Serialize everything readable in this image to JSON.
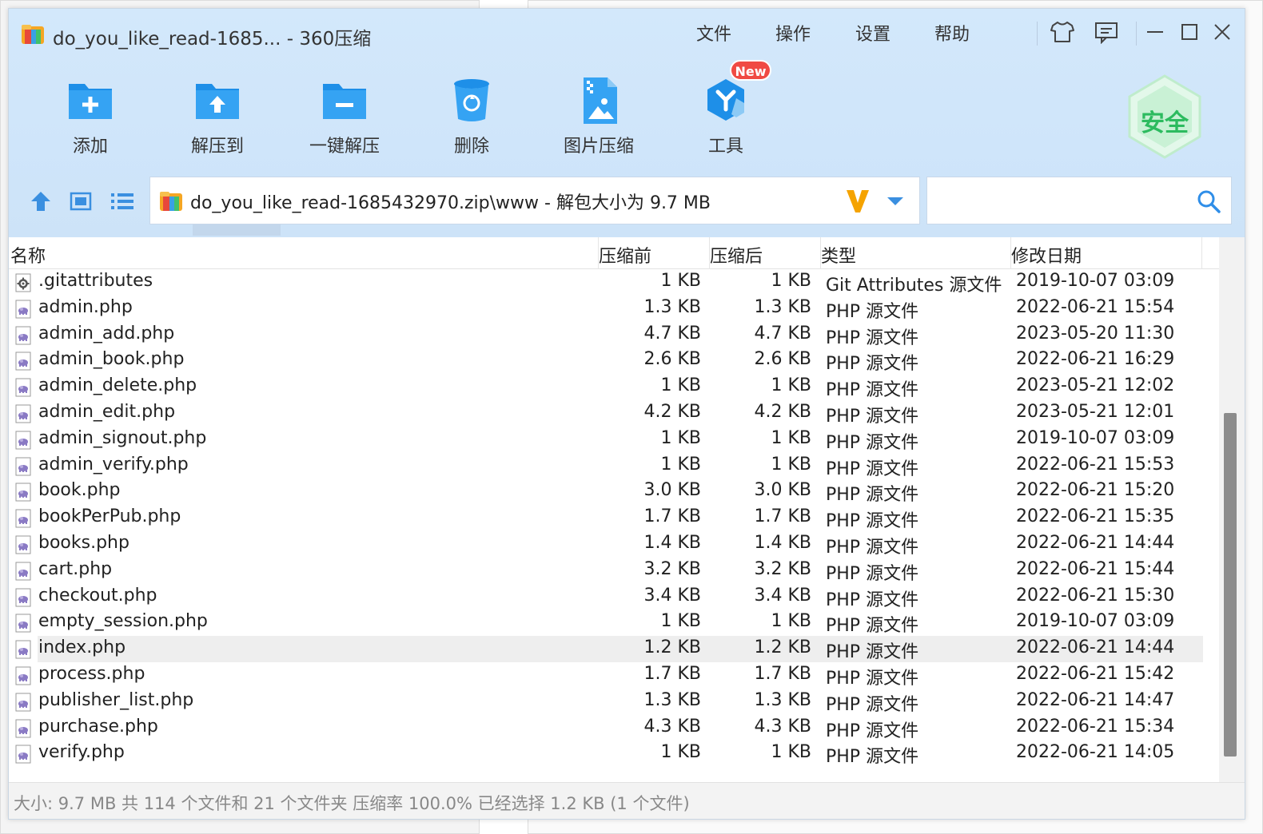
{
  "window": {
    "title": "do_you_like_read-1685... - 360压缩"
  },
  "menu": [
    "文件",
    "操作",
    "设置",
    "帮助"
  ],
  "window_controls": {
    "skin": "shirt-icon",
    "feedback": "message-icon",
    "minimize": "minimize-icon",
    "maximize": "maximize-icon",
    "close": "close-icon"
  },
  "toolbar": {
    "items": [
      {
        "label": "添加",
        "icon": "add-folder-icon"
      },
      {
        "label": "解压到",
        "icon": "extract-to-icon"
      },
      {
        "label": "一键解压",
        "icon": "one-click-extract-icon"
      },
      {
        "label": "删除",
        "icon": "delete-icon"
      },
      {
        "label": "图片压缩",
        "icon": "image-compress-icon"
      },
      {
        "label": "工具",
        "icon": "tools-icon"
      }
    ],
    "new_badge": "New",
    "security_label": "安全"
  },
  "address": {
    "path": "do_you_like_read-1685432970.zip\\www - 解包大小为 9.7 MB"
  },
  "search": {
    "placeholder": ""
  },
  "columns": {
    "name": "名称",
    "size": "压缩前",
    "compressed": "压缩后",
    "type": "类型",
    "modified": "修改日期"
  },
  "files": [
    {
      "name": ".gitattributes",
      "size": "1 KB",
      "compressed": "1 KB",
      "type": "Git Attributes 源文件",
      "modified": "2019-10-07 03:09",
      "icon": "settings-file-icon"
    },
    {
      "name": "admin.php",
      "size": "1.3 KB",
      "compressed": "1.3 KB",
      "type": "PHP 源文件",
      "modified": "2022-06-21 15:54",
      "icon": "php-file-icon"
    },
    {
      "name": "admin_add.php",
      "size": "4.7 KB",
      "compressed": "4.7 KB",
      "type": "PHP 源文件",
      "modified": "2023-05-20 11:30",
      "icon": "php-file-icon"
    },
    {
      "name": "admin_book.php",
      "size": "2.6 KB",
      "compressed": "2.6 KB",
      "type": "PHP 源文件",
      "modified": "2022-06-21 16:29",
      "icon": "php-file-icon"
    },
    {
      "name": "admin_delete.php",
      "size": "1 KB",
      "compressed": "1 KB",
      "type": "PHP 源文件",
      "modified": "2023-05-21 12:02",
      "icon": "php-file-icon"
    },
    {
      "name": "admin_edit.php",
      "size": "4.2 KB",
      "compressed": "4.2 KB",
      "type": "PHP 源文件",
      "modified": "2023-05-21 12:01",
      "icon": "php-file-icon"
    },
    {
      "name": "admin_signout.php",
      "size": "1 KB",
      "compressed": "1 KB",
      "type": "PHP 源文件",
      "modified": "2019-10-07 03:09",
      "icon": "php-file-icon"
    },
    {
      "name": "admin_verify.php",
      "size": "1 KB",
      "compressed": "1 KB",
      "type": "PHP 源文件",
      "modified": "2022-06-21 15:53",
      "icon": "php-file-icon"
    },
    {
      "name": "book.php",
      "size": "3.0 KB",
      "compressed": "3.0 KB",
      "type": "PHP 源文件",
      "modified": "2022-06-21 15:20",
      "icon": "php-file-icon"
    },
    {
      "name": "bookPerPub.php",
      "size": "1.7 KB",
      "compressed": "1.7 KB",
      "type": "PHP 源文件",
      "modified": "2022-06-21 15:35",
      "icon": "php-file-icon"
    },
    {
      "name": "books.php",
      "size": "1.4 KB",
      "compressed": "1.4 KB",
      "type": "PHP 源文件",
      "modified": "2022-06-21 14:44",
      "icon": "php-file-icon"
    },
    {
      "name": "cart.php",
      "size": "3.2 KB",
      "compressed": "3.2 KB",
      "type": "PHP 源文件",
      "modified": "2022-06-21 15:44",
      "icon": "php-file-icon"
    },
    {
      "name": "checkout.php",
      "size": "3.4 KB",
      "compressed": "3.4 KB",
      "type": "PHP 源文件",
      "modified": "2022-06-21 15:30",
      "icon": "php-file-icon"
    },
    {
      "name": "empty_session.php",
      "size": "1 KB",
      "compressed": "1 KB",
      "type": "PHP 源文件",
      "modified": "2019-10-07 03:09",
      "icon": "php-file-icon"
    },
    {
      "name": "index.php",
      "size": "1.2 KB",
      "compressed": "1.2 KB",
      "type": "PHP 源文件",
      "modified": "2022-06-21 14:44",
      "icon": "php-file-icon",
      "selected": true
    },
    {
      "name": "process.php",
      "size": "1.7 KB",
      "compressed": "1.7 KB",
      "type": "PHP 源文件",
      "modified": "2022-06-21 15:42",
      "icon": "php-file-icon"
    },
    {
      "name": "publisher_list.php",
      "size": "1.3 KB",
      "compressed": "1.3 KB",
      "type": "PHP 源文件",
      "modified": "2022-06-21 14:47",
      "icon": "php-file-icon"
    },
    {
      "name": "purchase.php",
      "size": "4.3 KB",
      "compressed": "4.3 KB",
      "type": "PHP 源文件",
      "modified": "2022-06-21 15:34",
      "icon": "php-file-icon"
    },
    {
      "name": "verify.php",
      "size": "1 KB",
      "compressed": "1 KB",
      "type": "PHP 源文件",
      "modified": "2022-06-21 14:05",
      "icon": "php-file-icon"
    }
  ],
  "status": {
    "text": "大小: 9.7 MB 共 114 个文件和 21 个文件夹 压缩率 100.0% 已经选择 1.2 KB (1 个文件)"
  },
  "colors": {
    "accent": "#1e8fe8",
    "toolbar_bg": "#d3e8fb",
    "badge": "#f04a43",
    "security": "#2dbb5f"
  }
}
